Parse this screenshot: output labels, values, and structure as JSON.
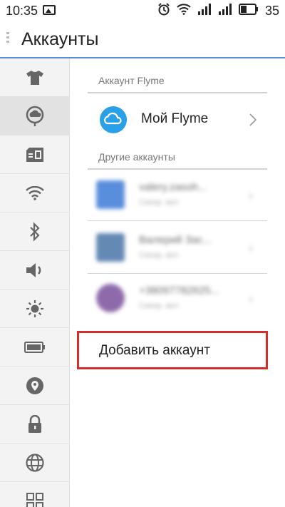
{
  "status_bar": {
    "time": "10:35",
    "battery": "35"
  },
  "header": {
    "title": "Аккаунты"
  },
  "sidebar": {
    "items": [
      {
        "icon": "theme-shirt-icon"
      },
      {
        "icon": "account-icon",
        "active": true
      },
      {
        "icon": "sim-card-icon"
      },
      {
        "icon": "wifi-icon"
      },
      {
        "icon": "bluetooth-icon"
      },
      {
        "icon": "sound-icon"
      },
      {
        "icon": "brightness-icon"
      },
      {
        "icon": "battery-icon"
      },
      {
        "icon": "location-icon"
      },
      {
        "icon": "lock-icon"
      },
      {
        "icon": "globe-icon"
      },
      {
        "icon": "apps-icon"
      }
    ]
  },
  "flyme_section": {
    "label": "Аккаунт Flyme",
    "account_name": "Мой Flyme"
  },
  "other_section": {
    "label": "Другие аккаунты",
    "accounts": [
      {
        "name": "valery.zasoh...",
        "sub": "Синхр. вкл",
        "color": "#3d7bd6"
      },
      {
        "name": "Валерий Зас...",
        "sub": "Синхр. вкл",
        "color": "#4a76a8"
      },
      {
        "name": "+38097782625...",
        "sub": "Синхр. вкл",
        "color": "#7b519d"
      }
    ]
  },
  "add_account": {
    "label": "Добавить аккаунт"
  },
  "colors": {
    "accent": "#5a8fd6",
    "flyme_cloud": "#2aa0e8",
    "highlight_border": "#d32f2f"
  }
}
